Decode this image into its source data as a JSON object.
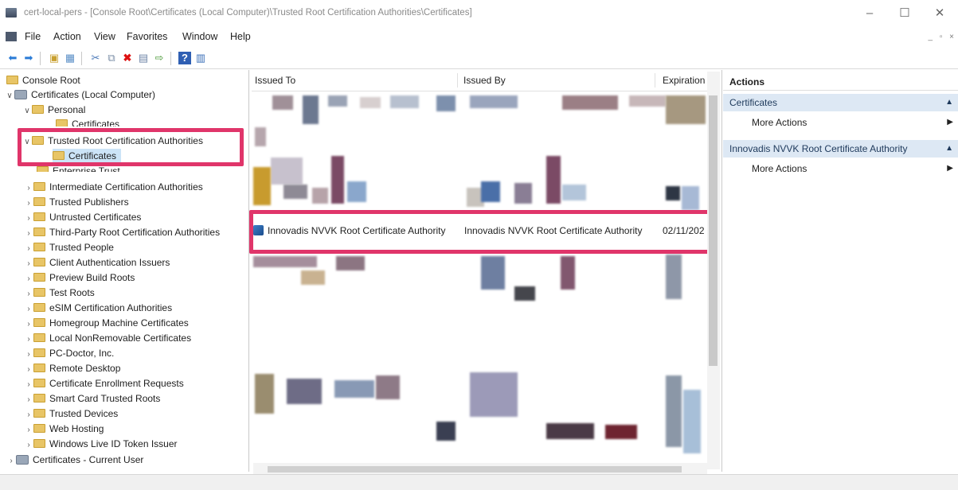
{
  "window": {
    "title": "cert-local-pers - [Console Root\\Certificates (Local Computer)\\Trusted Root Certification Authorities\\Certificates]",
    "controls": [
      "minimize",
      "maximize",
      "close"
    ]
  },
  "menu": {
    "items": [
      "File",
      "Action",
      "View",
      "Favorites",
      "Window",
      "Help"
    ]
  },
  "toolbar": {
    "buttons": [
      "back-icon",
      "forward-icon",
      "up-folder-icon",
      "show-tree-icon",
      "cut-icon",
      "copy-icon",
      "delete-icon",
      "properties-icon",
      "export-icon",
      "help-icon",
      "action-pane-icon"
    ]
  },
  "tree": {
    "items": [
      {
        "label": "Console Root"
      },
      {
        "label": "Certificates (Local Computer)"
      },
      {
        "label": "Personal"
      },
      {
        "label": "Certificates"
      },
      {
        "label": "Trusted Root Certification Authorities"
      },
      {
        "label": "Certificates"
      },
      {
        "label": "Enterprise Trust"
      },
      {
        "label": "Intermediate Certification Authorities"
      },
      {
        "label": "Trusted Publishers"
      },
      {
        "label": "Untrusted Certificates"
      },
      {
        "label": "Third-Party Root Certification Authorities"
      },
      {
        "label": "Trusted People"
      },
      {
        "label": "Client Authentication Issuers"
      },
      {
        "label": "Preview Build Roots"
      },
      {
        "label": "Test Roots"
      },
      {
        "label": "eSIM Certification Authorities"
      },
      {
        "label": "Homegroup Machine Certificates"
      },
      {
        "label": "Local NonRemovable Certificates"
      },
      {
        "label": "PC-Doctor, Inc."
      },
      {
        "label": "Remote Desktop"
      },
      {
        "label": "Certificate Enrollment Requests"
      },
      {
        "label": "Smart Card Trusted Roots"
      },
      {
        "label": "Trusted Devices"
      },
      {
        "label": "Web Hosting"
      },
      {
        "label": "Windows Live ID Token Issuer"
      },
      {
        "label": "Certificates - Current User"
      }
    ]
  },
  "list": {
    "columns": [
      "Issued To",
      "Issued By",
      "Expiration ^"
    ],
    "highlighted_row": {
      "issued_to": "Innovadis NVVK Root Certificate Authority",
      "issued_by": "Innovadis NVVK Root Certificate Authority",
      "expiration": "02/11/202"
    }
  },
  "actions": {
    "header": "Actions",
    "sections": [
      {
        "title": "Certificates",
        "items": [
          "More Actions"
        ]
      },
      {
        "title": "Innovadis NVVK Root Certificate Authority",
        "items": [
          "More Actions"
        ]
      }
    ]
  },
  "colors": {
    "highlight": "#e0356a",
    "selection": "#cce4f7",
    "section_bg": "#dde8f4"
  }
}
